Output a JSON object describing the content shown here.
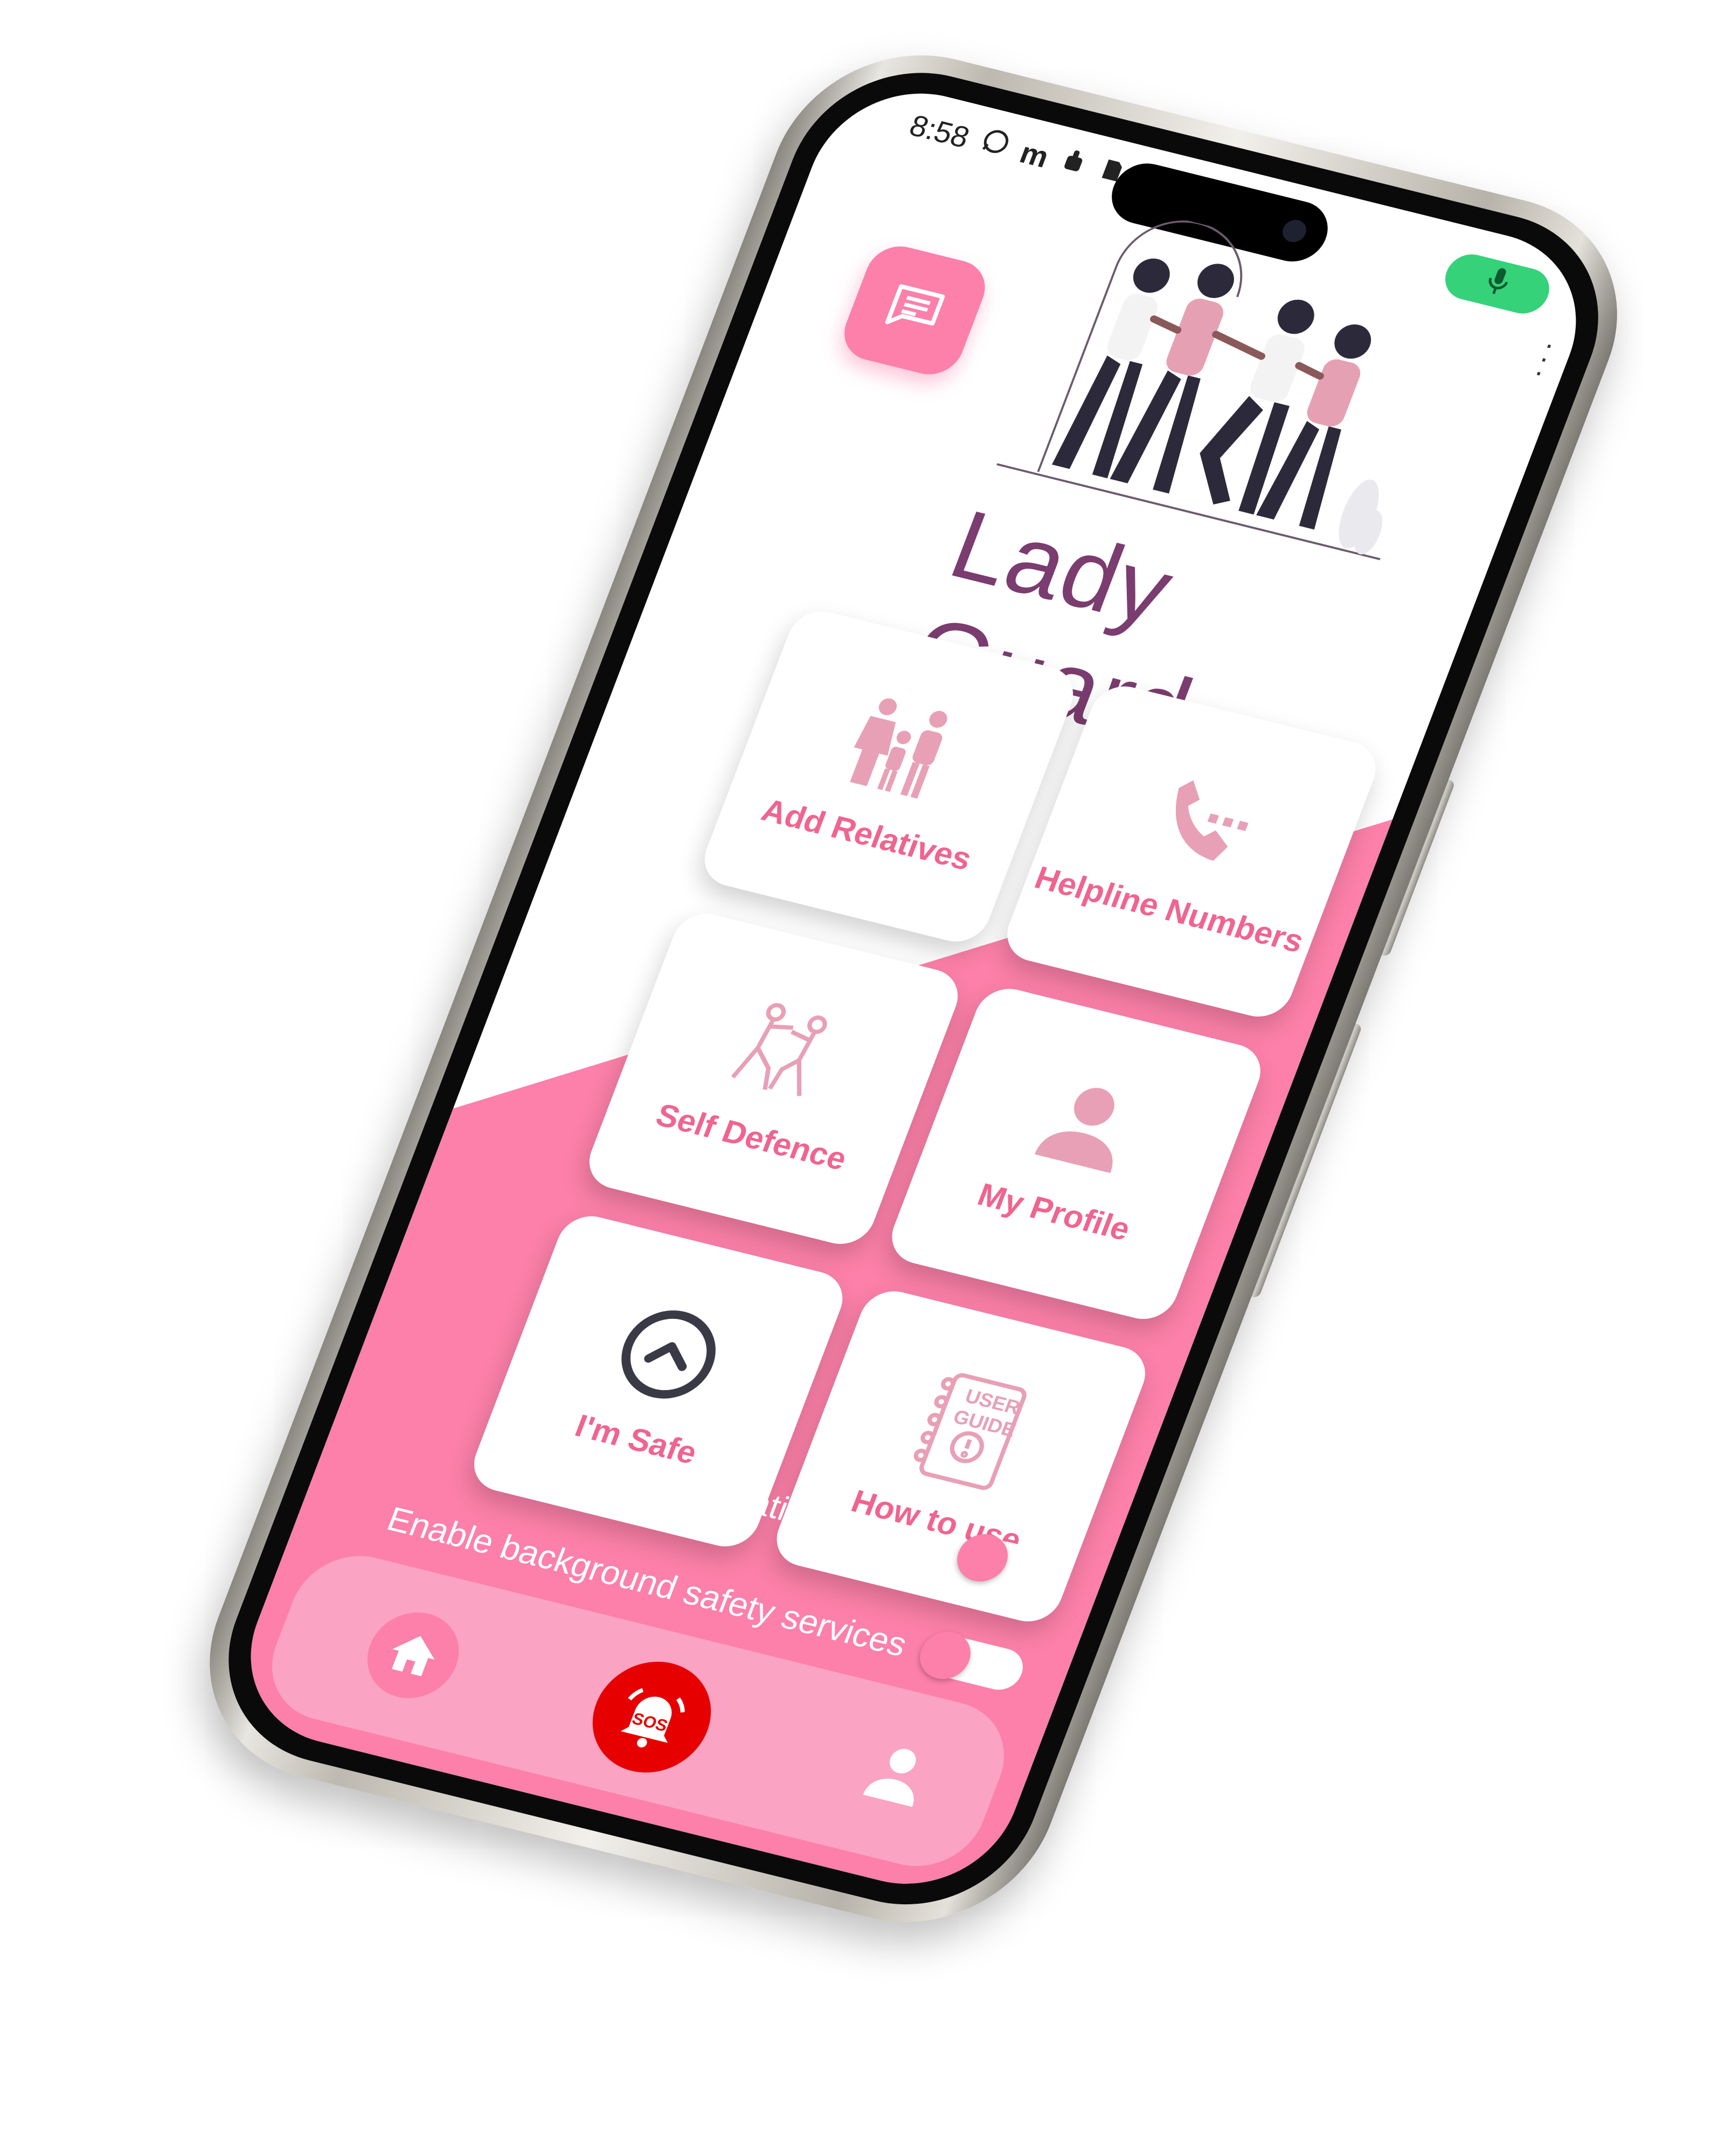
{
  "status_bar": {
    "time": "8:58",
    "icons": [
      "whatsapp-icon",
      "m-app-icon",
      "hand-icon",
      "sim-icon"
    ]
  },
  "mic_indicator": "mic-icon",
  "header": {
    "chat_icon": "chat-bubble-icon",
    "illustration": "women-group-illustration"
  },
  "app": {
    "title": "Lady Guard"
  },
  "tiles": [
    {
      "label": "Add Relatives",
      "icon": "family-icon"
    },
    {
      "label": "Helpline Numbers",
      "icon": "phone-dots-icon"
    },
    {
      "label": "Self Defence",
      "icon": "fighters-icon"
    },
    {
      "label": "My Profile",
      "icon": "person-icon"
    },
    {
      "label": "I'm Safe",
      "icon": "up-arrow-circle-icon"
    },
    {
      "label": "How to use",
      "icon": "user-guide-icon",
      "icon_text_1": "USER",
      "icon_text_2": "GUIDE"
    }
  ],
  "toggles": [
    {
      "label": "Enable live location sharing",
      "on": false
    },
    {
      "label": "Enable background safety services",
      "on": false
    }
  ],
  "bottom_nav": {
    "items": [
      "home-icon",
      "sos-icon",
      "profile-icon"
    ],
    "sos_text": "SOS"
  },
  "colors": {
    "accent_pink": "#fc80a9",
    "title_purple": "#7b3c6f",
    "sos_red": "#e60000"
  }
}
